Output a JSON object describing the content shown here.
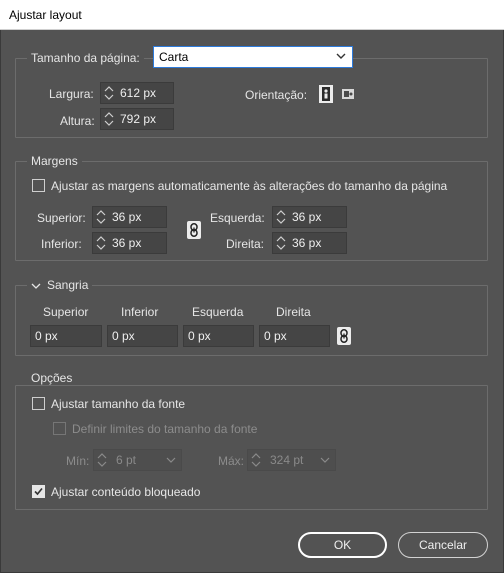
{
  "window": {
    "title": "Ajustar layout"
  },
  "page_size": {
    "label": "Tamanho da página:",
    "selected": "Carta"
  },
  "width": {
    "label": "Largura:",
    "value": "612 px"
  },
  "height": {
    "label": "Altura:",
    "value": "792 px"
  },
  "orientation": {
    "label": "Orientação:"
  },
  "margins": {
    "legend": "Margens",
    "auto_adjust_label": "Ajustar as margens automaticamente às alterações do tamanho da página",
    "auto_adjust_checked": false,
    "top": {
      "label": "Superior:",
      "value": "36 px"
    },
    "bottom": {
      "label": "Inferior:",
      "value": "36 px"
    },
    "left": {
      "label": "Esquerda:",
      "value": "36 px"
    },
    "right": {
      "label": "Direita:",
      "value": "36 px"
    }
  },
  "bleed": {
    "legend": "Sangria",
    "columns": [
      "Superior",
      "Inferior",
      "Esquerda",
      "Direita"
    ],
    "values": [
      "0 px",
      "0 px",
      "0 px",
      "0 px"
    ]
  },
  "options": {
    "legend": "Opções",
    "adjust_font_label": "Ajustar tamanho da fonte",
    "adjust_font_checked": false,
    "font_limits_label": "Definir limites do tamanho da fonte",
    "font_limits_checked": false,
    "min": {
      "label": "Mín:",
      "value": "6 pt"
    },
    "max": {
      "label": "Máx:",
      "value": "324 pt"
    },
    "locked_label": "Ajustar conteúdo bloqueado",
    "locked_checked": true
  },
  "buttons": {
    "ok": "OK",
    "cancel": "Cancelar"
  },
  "colors": {
    "background": "#535353",
    "titlebar": "#ffffff",
    "select_focus": "#2d7bdc"
  }
}
